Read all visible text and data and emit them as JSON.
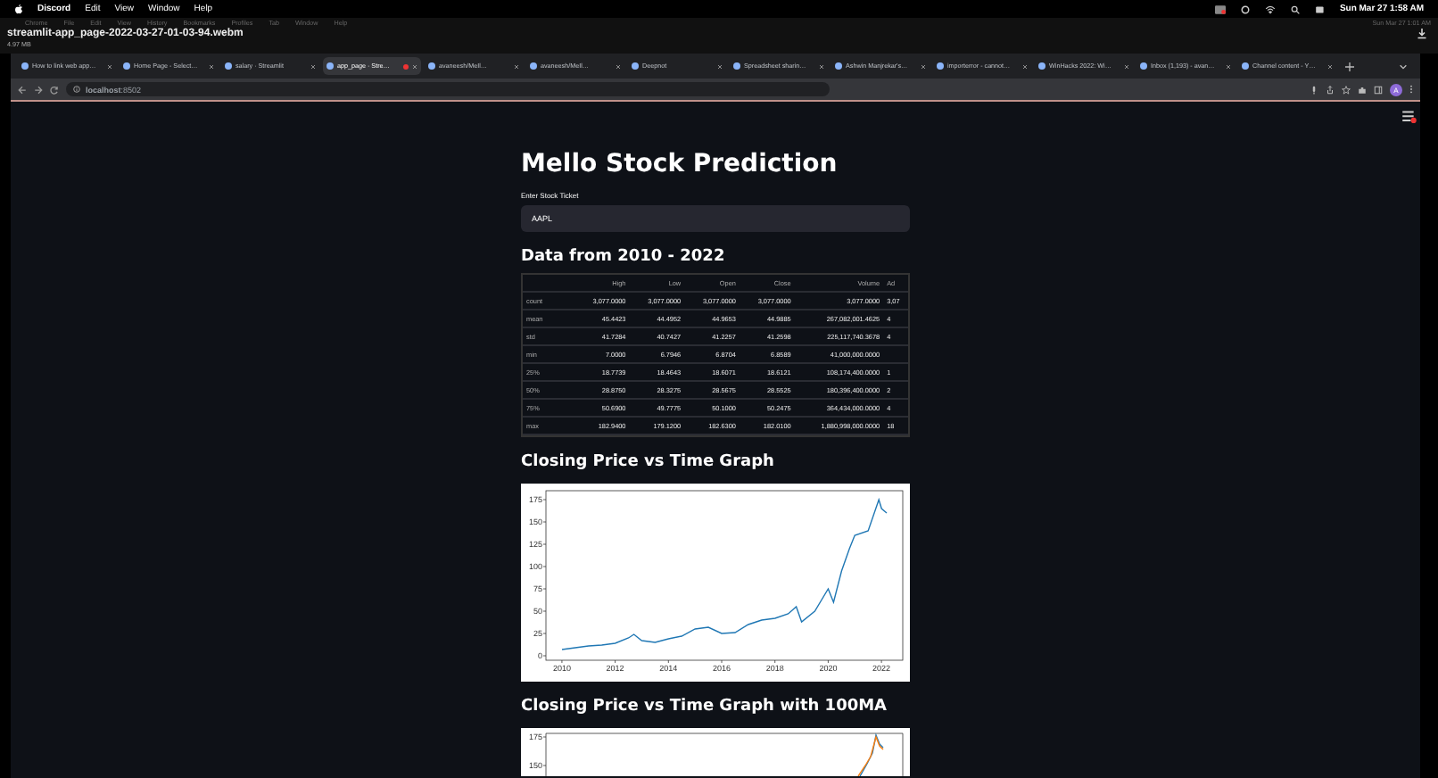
{
  "menu_bar": {
    "app": "Discord",
    "items": [
      "Edit",
      "View",
      "Window",
      "Help"
    ],
    "clock": "Sun Mar 27 1:58 AM"
  },
  "video": {
    "faded_menu": [
      "Chrome",
      "File",
      "Edit",
      "View",
      "History",
      "Bookmarks",
      "Profiles",
      "Tab",
      "Window",
      "Help"
    ],
    "faded_clock": "Sun Mar 27 1:01 AM",
    "filename": "streamlit-app_page-2022-03-27-01-03-94.webm",
    "size": "4.97 MB"
  },
  "browser": {
    "tabs": [
      {
        "label": "How to link web app…",
        "selected": false
      },
      {
        "label": "Home Page - Select…",
        "selected": false
      },
      {
        "label": "salary · Streamlit",
        "selected": false
      },
      {
        "label": "app_page · Stre…",
        "selected": true
      },
      {
        "label": "avaneesh/MeIl…",
        "selected": false
      },
      {
        "label": "avaneesh/MeIl…",
        "selected": false
      },
      {
        "label": "Deepnot",
        "selected": false
      },
      {
        "label": "Spreadsheet sharin…",
        "selected": false
      },
      {
        "label": "Ashwin Manjrekar's…",
        "selected": false
      },
      {
        "label": "importerror - cannot…",
        "selected": false
      },
      {
        "label": "WinHacks 2022: Wi…",
        "selected": false
      },
      {
        "label": "Inbox (1,193) - avan…",
        "selected": false
      },
      {
        "label": "Channel content - Y…",
        "selected": false
      }
    ],
    "address": "**localhost**:8502",
    "avatar": "A"
  },
  "page": {
    "title": "Mello Stock Prediction",
    "ticker_label": "Enter Stock Ticket",
    "ticker_value": "AAPL",
    "table_heading": "Data from 2010 - 2022",
    "table": {
      "columns": [
        "",
        "High",
        "Low",
        "Open",
        "Close",
        "Volume",
        "Ad"
      ],
      "rows": [
        [
          "count",
          "3,077.0000",
          "3,077.0000",
          "3,077.0000",
          "3,077.0000",
          "3,077.0000",
          "3,07"
        ],
        [
          "mean",
          "45.4423",
          "44.4952",
          "44.9653",
          "44.9885",
          "267,082,001.4625",
          "4"
        ],
        [
          "std",
          "41.7284",
          "40.7427",
          "41.2257",
          "41.2598",
          "225,117,740.3678",
          "4"
        ],
        [
          "min",
          "7.0000",
          "6.7946",
          "6.8704",
          "6.8589",
          "41,000,000.0000",
          ""
        ],
        [
          "25%",
          "18.7739",
          "18.4643",
          "18.6071",
          "18.6121",
          "108,174,400.0000",
          "1"
        ],
        [
          "50%",
          "28.8750",
          "28.3275",
          "28.5675",
          "28.5525",
          "180,396,400.0000",
          "2"
        ],
        [
          "75%",
          "50.6900",
          "49.7775",
          "50.1000",
          "50.2475",
          "364,434,000.0000",
          "4"
        ],
        [
          "max",
          "182.9400",
          "179.1200",
          "182.6300",
          "182.0100",
          "1,880,998,000.0000",
          "18"
        ]
      ]
    },
    "chart1_heading": "Closing Price vs Time Graph",
    "chart1": {
      "chart_data": {
        "type": "line",
        "x": [
          2010,
          2010.5,
          2011,
          2011.5,
          2012,
          2012.5,
          2012.7,
          2013,
          2013.5,
          2014,
          2014.5,
          2015,
          2015.5,
          2016,
          2016.5,
          2017,
          2017.5,
          2018,
          2018.5,
          2018.8,
          2019,
          2019.5,
          2020,
          2020.2,
          2020.5,
          2020.8,
          2021,
          2021.5,
          2021.9,
          2022,
          2022.2
        ],
        "series": [
          {
            "color": "#1f77b4",
            "values": [
              7,
              9,
              11,
              12,
              14,
              20,
              24,
              17,
              15,
              19,
              22,
              30,
              32,
              25,
              26,
              35,
              40,
              42,
              47,
              55,
              38,
              50,
              75,
              60,
              95,
              120,
              135,
              140,
              175,
              165,
              160
            ]
          }
        ],
        "xlim": [
          2009.4,
          2022.8
        ],
        "ylim": [
          -5,
          185
        ],
        "xticks": [
          2010,
          2012,
          2014,
          2016,
          2018,
          2020,
          2022
        ],
        "yticks": [
          0,
          25,
          50,
          75,
          100,
          125,
          150,
          175
        ]
      }
    },
    "chart2_heading": "Closing Price vs Time Graph with 100MA",
    "chart2": {
      "y_tick_labels": [
        "175",
        "150"
      ]
    }
  }
}
